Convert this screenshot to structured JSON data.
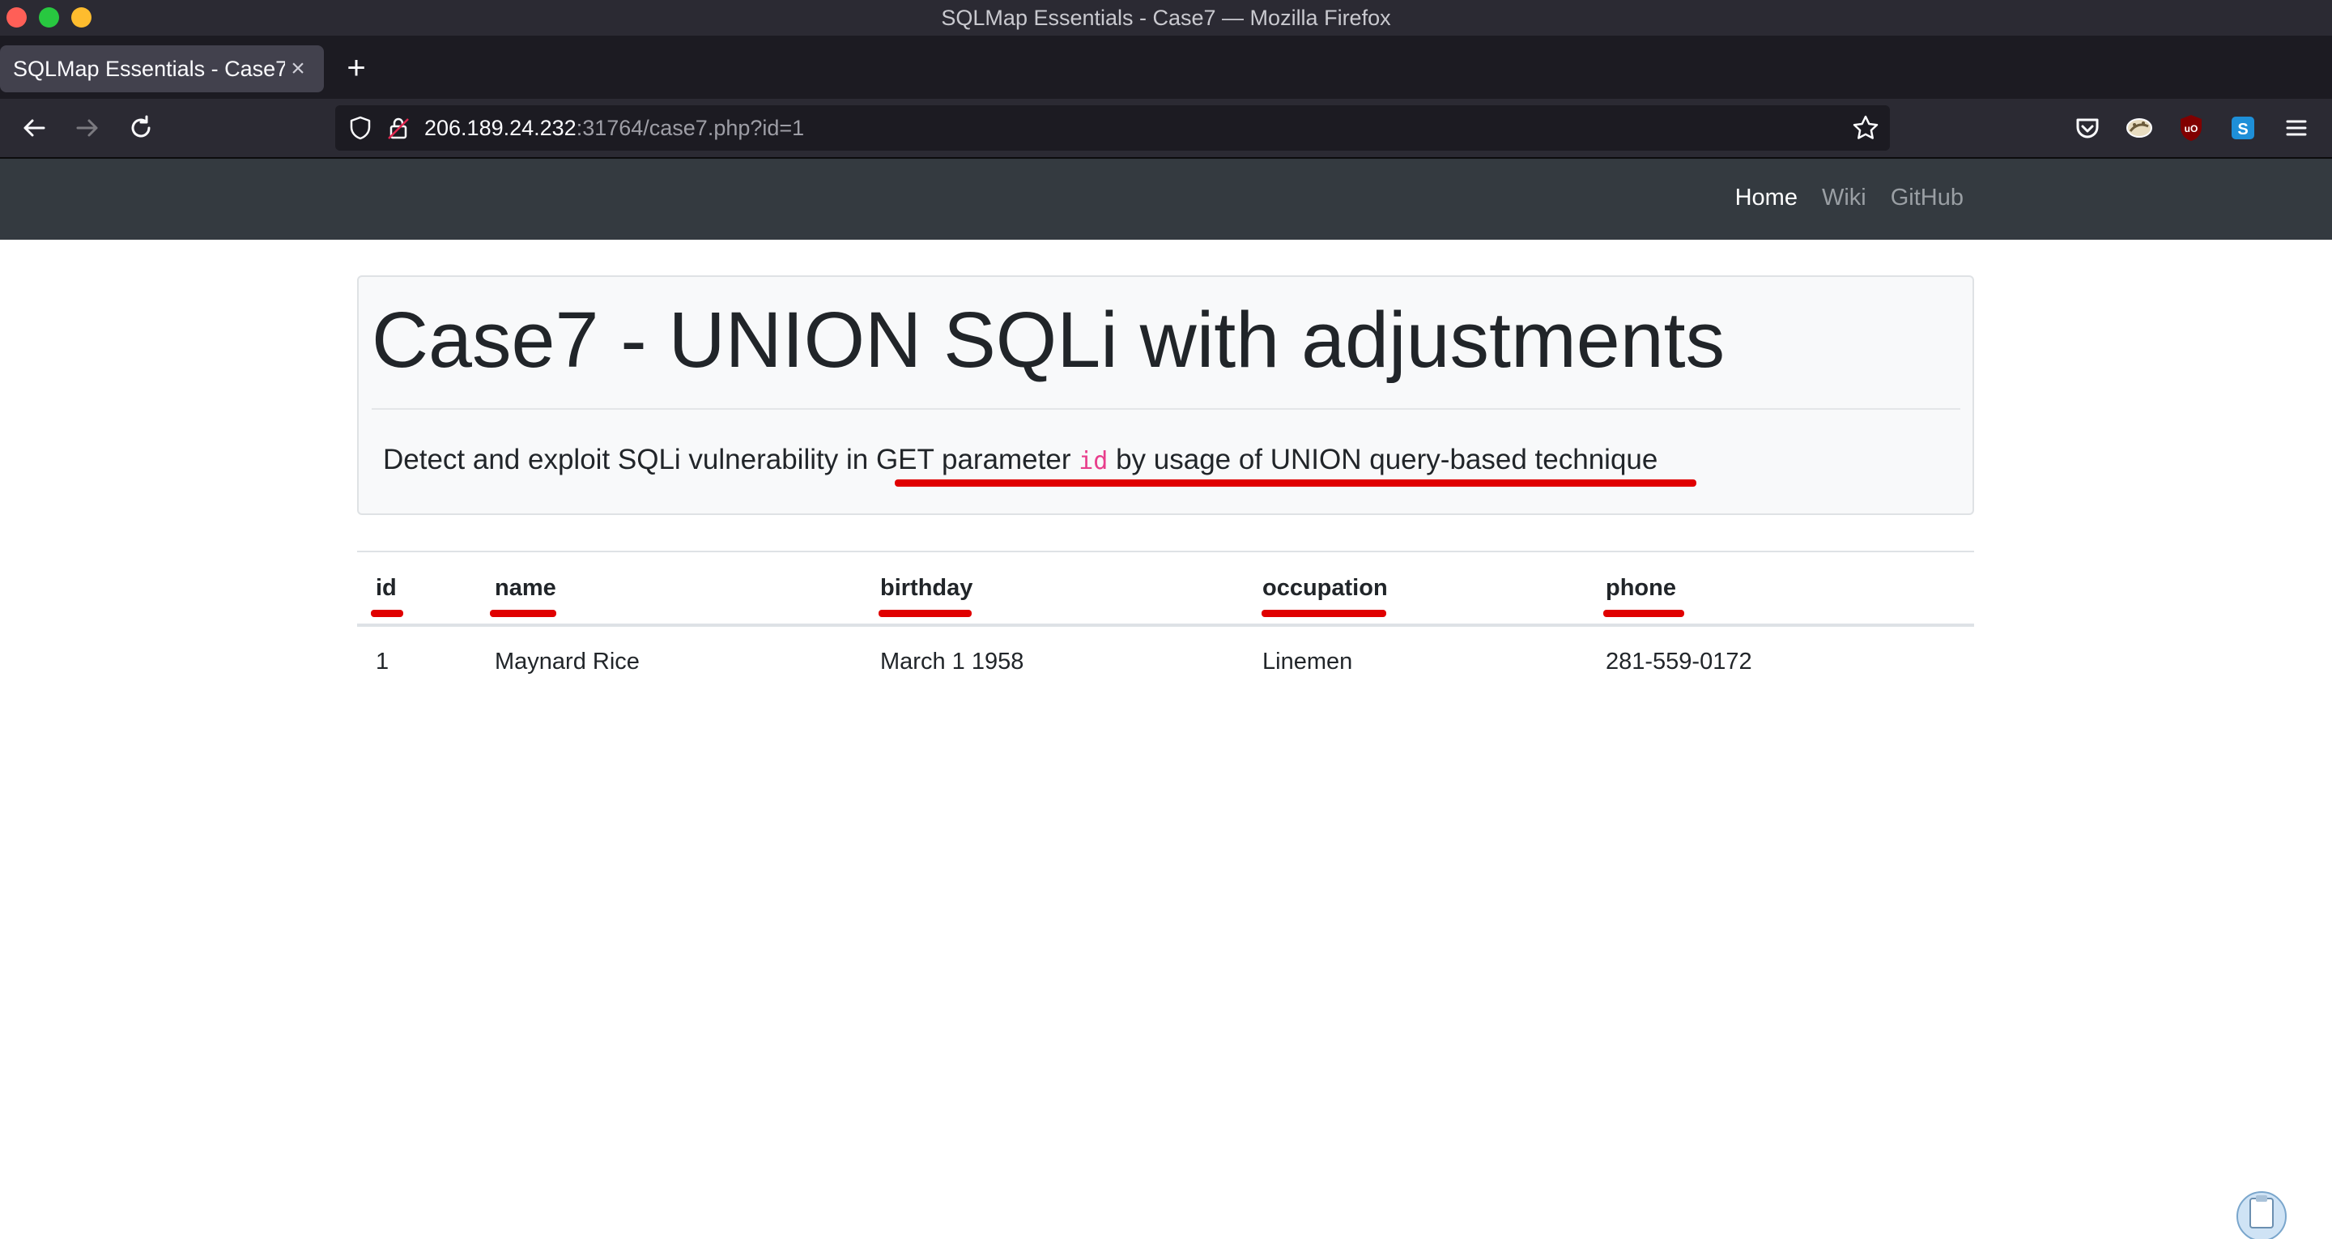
{
  "window": {
    "title": "SQLMap Essentials - Case7 — Mozilla Firefox"
  },
  "tabs": [
    {
      "title": "SQLMap Essentials - Case7",
      "active": true
    }
  ],
  "urlbar": {
    "host": "206.189.24.232",
    "path": ":31764/case7.php?id=1"
  },
  "site_nav": {
    "home": "Home",
    "wiki": "Wiki",
    "github": "GitHub"
  },
  "jumbotron": {
    "title": "Case7 - UNION SQLi with adjustments",
    "lead_prefix": "Detect and exploit SQLi vulnerability in ",
    "lead_highlight_a": "GET parameter ",
    "lead_code": "id",
    "lead_highlight_b": " by usage of UNION query-based technique"
  },
  "table": {
    "headers": [
      "id",
      "name",
      "birthday",
      "occupation",
      "phone"
    ],
    "rows": [
      [
        "1",
        "Maynard Rice",
        "March 1 1958",
        "Linemen",
        "281-559-0172"
      ]
    ]
  },
  "colors": {
    "annotation": "#e00000",
    "header_bg": "#343a40",
    "code": "#e83e8c"
  }
}
